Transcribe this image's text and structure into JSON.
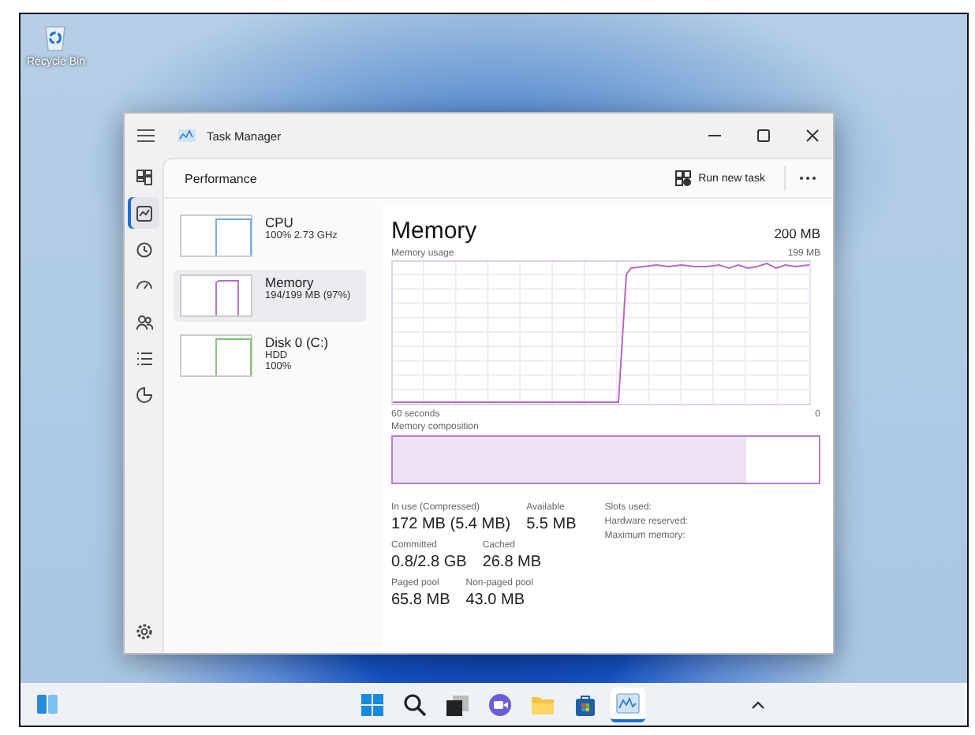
{
  "desktop": {
    "icons": [
      {
        "kind": "recycle-bin",
        "label": "Recycle Bin"
      }
    ]
  },
  "window": {
    "title": "Task Manager"
  },
  "nav": {
    "items": [
      {
        "kind": "processes",
        "selected": false
      },
      {
        "kind": "performance",
        "selected": true
      },
      {
        "kind": "history",
        "selected": false
      },
      {
        "kind": "startup",
        "selected": false
      },
      {
        "kind": "users",
        "selected": false
      },
      {
        "kind": "details",
        "selected": false
      },
      {
        "kind": "services",
        "selected": false
      }
    ]
  },
  "page": {
    "title": "Performance",
    "action": "Run new task"
  },
  "devices": [
    {
      "kind": "cpu",
      "name": "CPU",
      "details": [
        "100% 2.73 GHz"
      ],
      "color": "#6ea8dc",
      "selected": false
    },
    {
      "kind": "memory",
      "name": "Memory",
      "details": [
        "194/199 MB (97%)"
      ],
      "color": "#b468c8",
      "selected": true
    },
    {
      "kind": "disk",
      "name": "Disk 0 (C:)",
      "details": [
        "HDD",
        "100%"
      ],
      "color": "#7cc36a",
      "selected": false
    }
  ],
  "memory": {
    "title": "Memory",
    "capacity": "200 MB",
    "usage_label": "Memory usage",
    "usage_max": "199 MB",
    "time_label": "60 seconds",
    "time_end": "0",
    "composition_label": "Memory composition",
    "composition": {
      "level": 0.83
    },
    "stat_rows": [
      [
        {
          "label": "In use (Compressed)",
          "value": "172 MB (5.4 MB)"
        },
        {
          "label": "Available",
          "value": "5.5 MB"
        }
      ],
      [
        {
          "label": "Committed",
          "value": "0.8/2.8 GB"
        },
        {
          "label": "Cached",
          "value": "26.8 MB"
        }
      ],
      [
        {
          "label": "Paged pool",
          "value": "65.8 MB"
        },
        {
          "label": "Non-paged pool",
          "value": "43.0 MB"
        }
      ]
    ],
    "specs": [
      "Slots used:",
      "Hardware reserved:",
      "Maximum memory:"
    ]
  },
  "taskbar": {
    "items": [
      {
        "kind": "start",
        "selected": false
      },
      {
        "kind": "search",
        "selected": false
      },
      {
        "kind": "taskview",
        "selected": false
      },
      {
        "kind": "chat",
        "selected": false
      },
      {
        "kind": "explorer",
        "selected": false
      },
      {
        "kind": "store",
        "selected": false
      },
      {
        "kind": "taskmanager",
        "selected": true
      }
    ]
  }
}
